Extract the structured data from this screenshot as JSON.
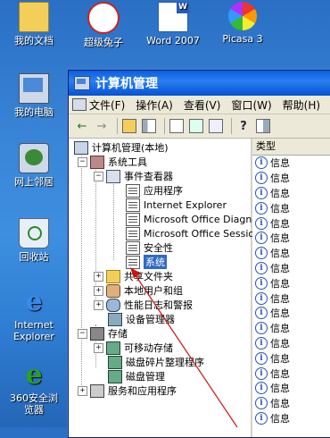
{
  "desktop": {
    "icons": [
      {
        "label": "我的文档"
      },
      {
        "label": "超级兔子"
      },
      {
        "label": "Word 2007"
      },
      {
        "label": "Picasa 3"
      },
      {
        "label": "我的电脑"
      },
      {
        "label": "网上邻居"
      },
      {
        "label": "回收站"
      },
      {
        "label": "Internet Explorer"
      },
      {
        "label": "360安全浏览器"
      }
    ]
  },
  "window": {
    "title": "计算机管理",
    "menu": [
      "文件(F)",
      "操作(A)",
      "查看(V)",
      "窗口(W)",
      "帮助(H)"
    ],
    "toolbar": [
      "back-icon",
      "forward-icon",
      "up-icon",
      "show-hide-tree-icon",
      "properties-icon",
      "refresh-icon",
      "export-icon",
      "help-icon",
      "console-icon"
    ]
  },
  "tree": {
    "root": "计算机管理(本地)",
    "system_tools": "系统工具",
    "event_viewer": "事件查看器",
    "logs": [
      "应用程序",
      "Internet Explorer",
      "Microsoft Office Diagnos",
      "Microsoft Office Session",
      "安全性",
      "系统"
    ],
    "shared_folders": "共享文件夹",
    "local_users": "本地用户和组",
    "perf_logs": "性能日志和警报",
    "device_manager": "设备管理器",
    "storage": "存储",
    "removable": "可移动存储",
    "defrag": "磁盘碎片整理程序",
    "disk_mgmt": "磁盘管理",
    "services_apps": "服务和应用程序"
  },
  "list": {
    "header": "类型",
    "rows": [
      "信息",
      "信息",
      "信息",
      "信息",
      "信息",
      "信息",
      "信息",
      "信息",
      "信息",
      "信息",
      "信息",
      "信息",
      "信息",
      "信息",
      "信息",
      "信息",
      "信息",
      "信息"
    ]
  },
  "colors": {
    "selection": "#316ac5",
    "annotation_arrow": "#cc1111"
  }
}
